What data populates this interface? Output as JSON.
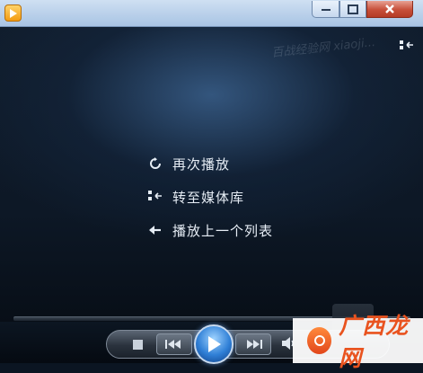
{
  "window": {
    "title": ""
  },
  "video": {
    "watermark": "百战经验网 xiaoji...",
    "menu": [
      {
        "id": "replay",
        "icon": "replay-icon",
        "label": "再次播放"
      },
      {
        "id": "library",
        "icon": "library-icon",
        "label": "转至媒体库"
      },
      {
        "id": "previous-list",
        "icon": "back-arrow-icon",
        "label": "播放上一个列表"
      }
    ]
  },
  "controls": {
    "stop": "stop-icon",
    "previous": "previous-icon",
    "play": "play-icon",
    "next": "next-icon",
    "volume": "volume-icon",
    "switch_view": "switch-to-library-icon"
  },
  "overlay": {
    "logo_text": "广西龙网"
  },
  "colors": {
    "accent": "#2f7fd6",
    "logo": "#e9531f",
    "titlebar": "#b9d0ea",
    "close": "#c74f39"
  }
}
